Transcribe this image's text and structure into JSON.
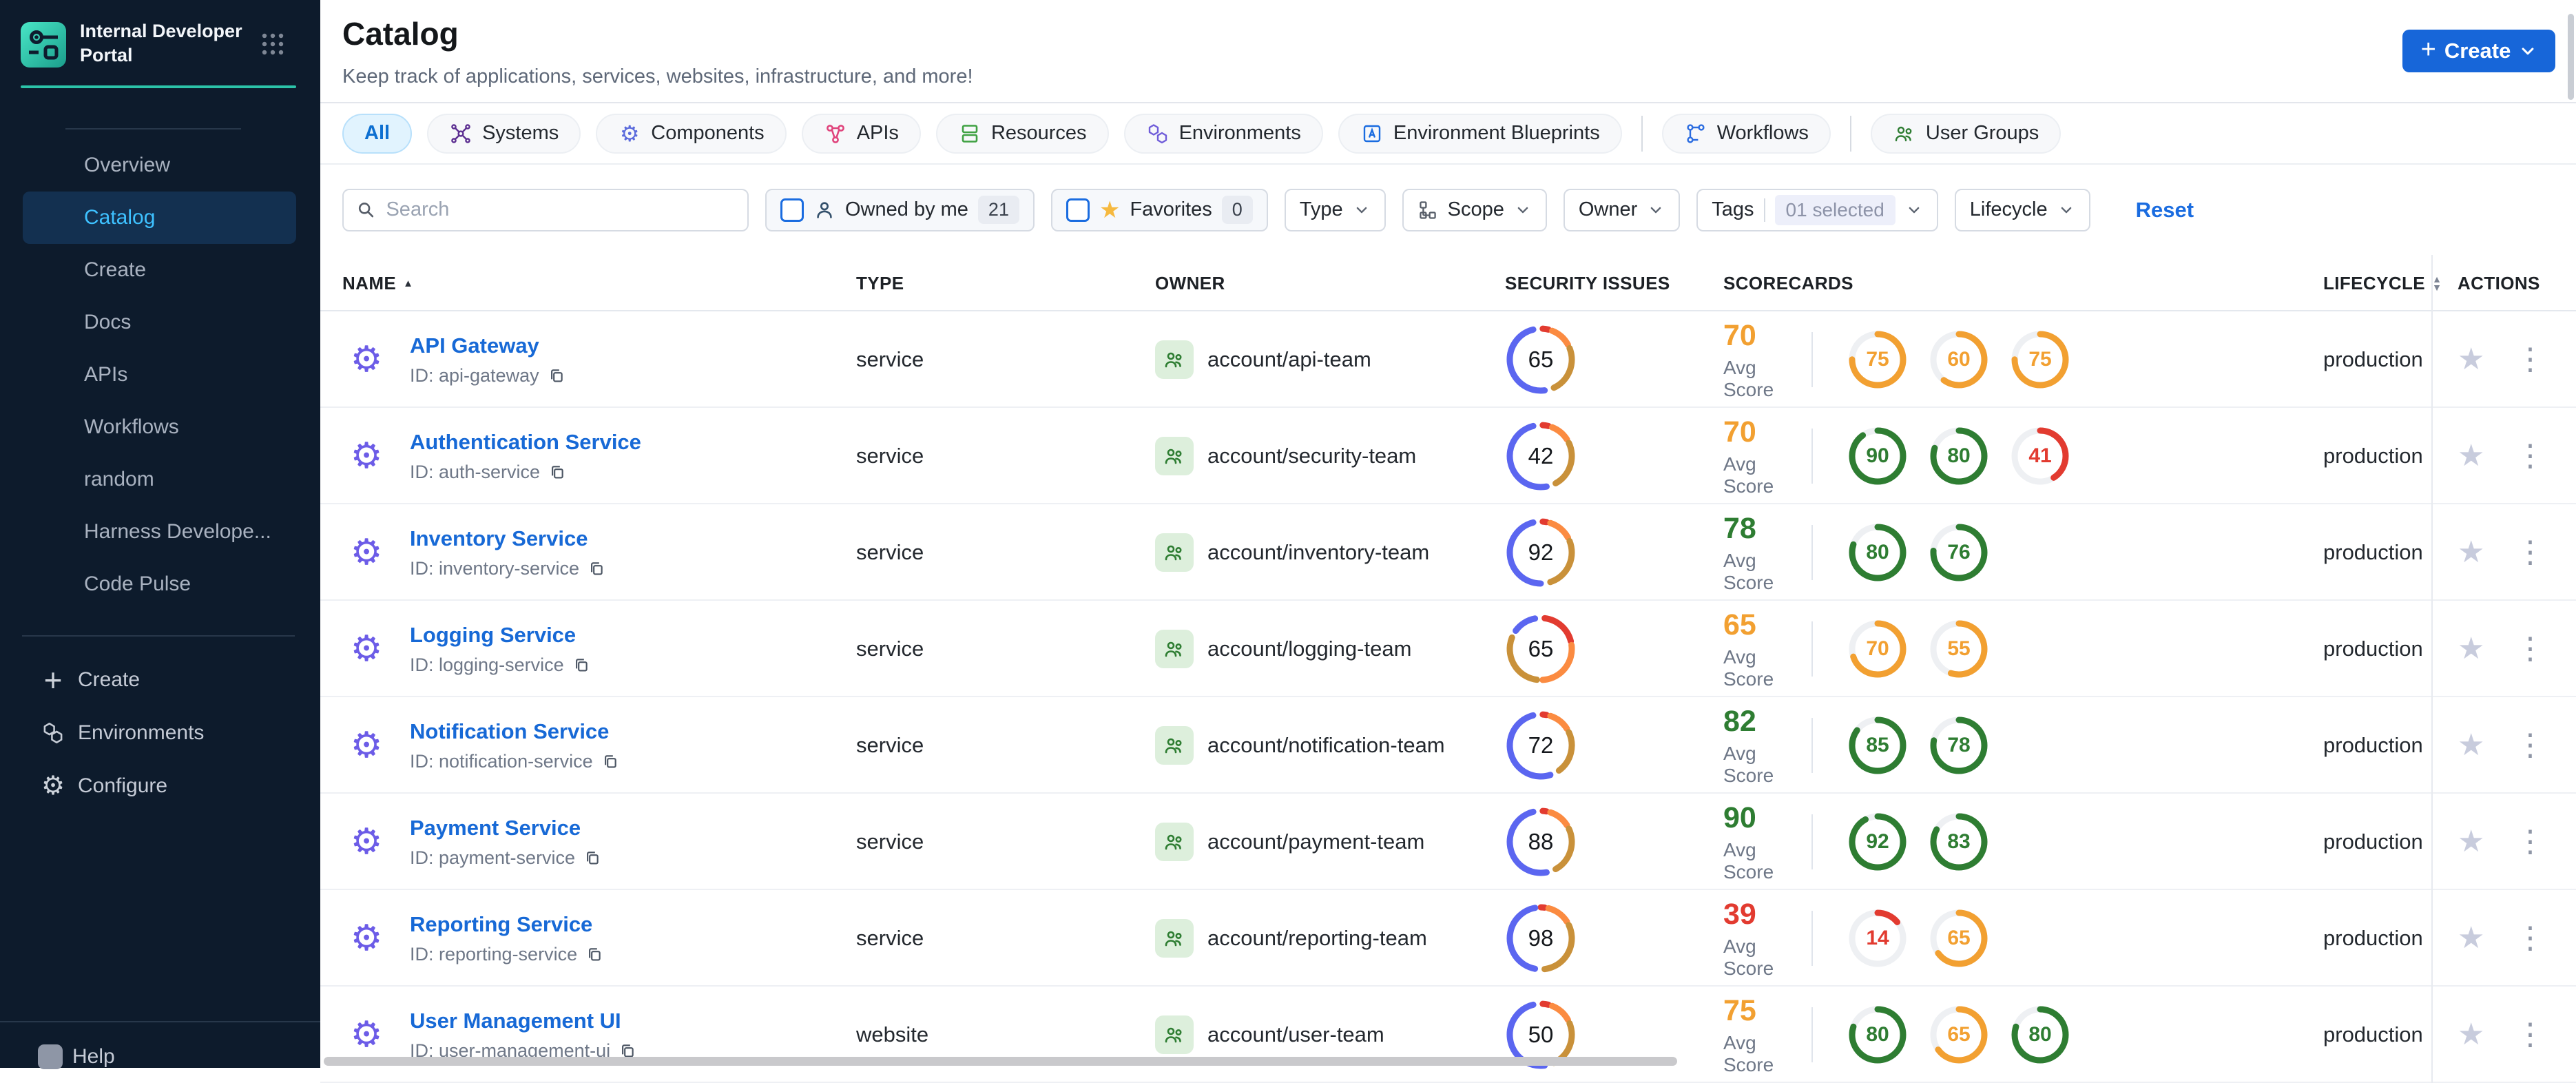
{
  "sidebar": {
    "brand": {
      "line1": "Internal Developer",
      "line2": "Portal"
    },
    "items": [
      {
        "label": "Overview",
        "active": false
      },
      {
        "label": "Catalog",
        "active": true
      },
      {
        "label": "Create",
        "active": false
      },
      {
        "label": "Docs",
        "active": false
      },
      {
        "label": "APIs",
        "active": false
      },
      {
        "label": "Workflows",
        "active": false
      },
      {
        "label": "random",
        "active": false
      },
      {
        "label": "Harness Develope...",
        "active": false
      },
      {
        "label": "Code Pulse",
        "active": false
      }
    ],
    "footer_items": [
      {
        "icon": "plus-icon",
        "label": "Create"
      },
      {
        "icon": "hexagons-icon",
        "label": "Environments"
      },
      {
        "icon": "gear-icon",
        "label": "Configure"
      }
    ],
    "help_label": "Help"
  },
  "header": {
    "title": "Catalog",
    "subtitle": "Keep track of applications, services, websites, infrastructure, and more!",
    "create_label": "Create"
  },
  "tabs": [
    {
      "label": "All",
      "icon": "none",
      "color": "#0d6fd1",
      "active": true
    },
    {
      "label": "Systems",
      "icon": "systems-icon",
      "color": "#5c2e91",
      "active": false
    },
    {
      "label": "Components",
      "icon": "components-icon",
      "color": "#5b6bdc",
      "active": false
    },
    {
      "label": "APIs",
      "icon": "apis-icon",
      "color": "#e0447c",
      "active": false
    },
    {
      "label": "Resources",
      "icon": "resources-icon",
      "color": "#3fa142",
      "active": false
    },
    {
      "label": "Environments",
      "icon": "environments-icon",
      "color": "#6f5cd9",
      "active": false
    },
    {
      "label": "Environment Blueprints",
      "icon": "environment-blueprints-icon",
      "color": "#1a6ce0",
      "active": false
    },
    {
      "label": "Workflows",
      "icon": "workflows-icon",
      "color": "#2b6ce0",
      "active": false,
      "divider_before": true
    },
    {
      "label": "User Groups",
      "icon": "user-groups-icon",
      "color": "#2e7d32",
      "active": false,
      "divider_before": true
    }
  ],
  "filters": {
    "search_placeholder": "Search",
    "owned_by_me": {
      "label": "Owned by me",
      "count": "21"
    },
    "favorites": {
      "label": "Favorites",
      "count": "0"
    },
    "type": {
      "label": "Type"
    },
    "scope": {
      "label": "Scope"
    },
    "owner": {
      "label": "Owner"
    },
    "tags": {
      "label": "Tags",
      "selected": "01 selected"
    },
    "lifecycle": {
      "label": "Lifecycle"
    },
    "reset_label": "Reset"
  },
  "table": {
    "columns": [
      "NAME",
      "TYPE",
      "OWNER",
      "SECURITY ISSUES",
      "SCORECARDS",
      "LIFECYCLE",
      "ACTIONS"
    ],
    "avg_score_label": "Avg Score"
  },
  "rows": [
    {
      "name": "API Gateway",
      "id_label": "ID: api-gateway",
      "type": "service",
      "owner": "account/api-team",
      "lifecycle": "production",
      "security": {
        "value": "65",
        "segments": [
          [
            "red",
            1,
            4
          ],
          [
            "orange",
            6,
            17
          ],
          [
            "amber",
            19,
            43
          ],
          [
            "blue",
            48,
            96
          ]
        ]
      },
      "scorecards": {
        "avg": "70",
        "avg_color": "orange",
        "rings": [
          {
            "value": 75,
            "color": "orange"
          },
          {
            "value": 60,
            "color": "orange"
          },
          {
            "value": 75,
            "color": "orange"
          }
        ]
      }
    },
    {
      "name": "Authentication Service",
      "id_label": "ID: auth-service",
      "type": "service",
      "owner": "account/security-team",
      "lifecycle": "production",
      "security": {
        "value": "42",
        "segments": [
          [
            "red",
            1,
            4
          ],
          [
            "orange",
            6,
            16
          ],
          [
            "amber",
            18,
            42
          ],
          [
            "blue",
            47,
            96
          ]
        ]
      },
      "scorecards": {
        "avg": "70",
        "avg_color": "orange",
        "rings": [
          {
            "value": 90,
            "color": "green"
          },
          {
            "value": 80,
            "color": "green"
          },
          {
            "value": 41,
            "color": "red"
          }
        ]
      }
    },
    {
      "name": "Inventory Service",
      "id_label": "ID: inventory-service",
      "type": "service",
      "owner": "account/inventory-team",
      "lifecycle": "production",
      "security": {
        "value": "92",
        "segments": [
          [
            "red",
            1,
            3
          ],
          [
            "orange",
            5,
            17
          ],
          [
            "amber",
            19,
            45
          ],
          [
            "blue",
            50,
            96
          ]
        ]
      },
      "scorecards": {
        "avg": "78",
        "avg_color": "green",
        "rings": [
          {
            "value": 80,
            "color": "green"
          },
          {
            "value": 76,
            "color": "green"
          }
        ]
      }
    },
    {
      "name": "Logging Service",
      "id_label": "ID: logging-service",
      "type": "service",
      "owner": "account/logging-team",
      "lifecycle": "production",
      "security": {
        "value": "65",
        "segments": [
          [
            "red",
            2,
            21
          ],
          [
            "orange",
            23,
            49
          ],
          [
            "amber",
            52,
            81
          ],
          [
            "blue",
            85,
            97
          ]
        ]
      },
      "scorecards": {
        "avg": "65",
        "avg_color": "orange",
        "rings": [
          {
            "value": 70,
            "color": "orange"
          },
          {
            "value": 55,
            "color": "orange"
          }
        ]
      }
    },
    {
      "name": "Notification Service",
      "id_label": "ID: notification-service",
      "type": "service",
      "owner": "account/notification-team",
      "lifecycle": "production",
      "security": {
        "value": "72",
        "segments": [
          [
            "red",
            1,
            3
          ],
          [
            "orange",
            5,
            16
          ],
          [
            "amber",
            18,
            40
          ],
          [
            "blue",
            45,
            96
          ]
        ]
      },
      "scorecards": {
        "avg": "82",
        "avg_color": "green",
        "rings": [
          {
            "value": 85,
            "color": "green"
          },
          {
            "value": 78,
            "color": "green"
          }
        ]
      }
    },
    {
      "name": "Payment Service",
      "id_label": "ID: payment-service",
      "type": "service",
      "owner": "account/payment-team",
      "lifecycle": "production",
      "security": {
        "value": "88",
        "segments": [
          [
            "red",
            1,
            3
          ],
          [
            "orange",
            5,
            16
          ],
          [
            "amber",
            18,
            42
          ],
          [
            "blue",
            47,
            96
          ]
        ]
      },
      "scorecards": {
        "avg": "90",
        "avg_color": "green",
        "rings": [
          {
            "value": 92,
            "color": "green"
          },
          {
            "value": 83,
            "color": "green"
          }
        ]
      }
    },
    {
      "name": "Reporting Service",
      "id_label": "ID: reporting-service",
      "type": "service",
      "owner": "account/reporting-team",
      "lifecycle": "production",
      "security": {
        "value": "98",
        "segments": [
          [
            "red",
            0,
            2
          ],
          [
            "orange",
            4,
            16
          ],
          [
            "amber",
            18,
            48
          ],
          [
            "blue",
            53,
            97
          ]
        ]
      },
      "scorecards": {
        "avg": "39",
        "avg_color": "red",
        "rings": [
          {
            "value": 14,
            "color": "red"
          },
          {
            "value": 65,
            "color": "orange"
          }
        ]
      }
    },
    {
      "name": "User Management UI",
      "id_label": "ID: user-management-ui",
      "type": "website",
      "owner": "account/user-team",
      "lifecycle": "production",
      "security": {
        "value": "50",
        "segments": [
          [
            "red",
            1,
            4
          ],
          [
            "orange",
            6,
            17
          ],
          [
            "amber",
            19,
            43
          ],
          [
            "blue",
            48,
            96
          ]
        ]
      },
      "scorecards": {
        "avg": "75",
        "avg_color": "orange",
        "rings": [
          {
            "value": 80,
            "color": "green"
          },
          {
            "value": 65,
            "color": "orange"
          },
          {
            "value": 80,
            "color": "green"
          }
        ]
      }
    }
  ],
  "colors": {
    "ring": {
      "green": "#2e7d32",
      "orange": "#f2a031",
      "red": "#e23b30"
    },
    "donut": {
      "blue": "#5b66f0",
      "red": "#e23b30",
      "orange": "#fb8b41",
      "amber": "#c9913a"
    },
    "accent_blue": "#1766d9",
    "link_blue": "#1769d6",
    "active_nav": "#3ec1ff",
    "teal": "#2cc3a9",
    "star_yellow": "#f6b93f"
  }
}
